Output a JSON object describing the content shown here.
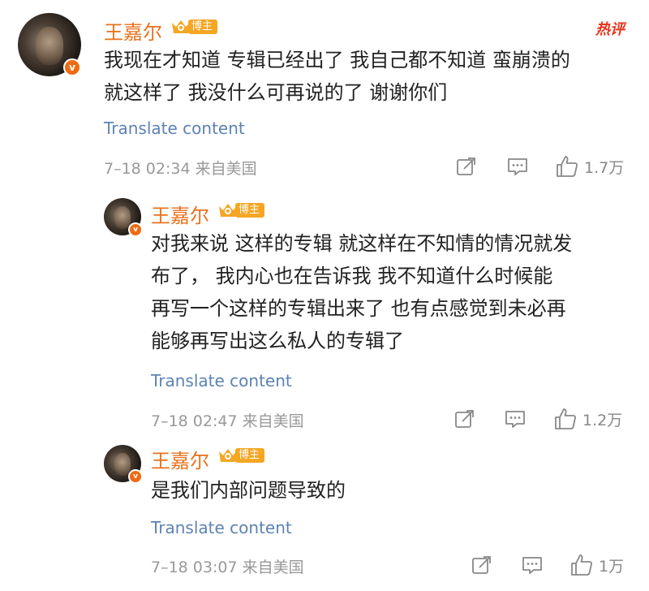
{
  "hot_label": "热评",
  "badge_label": "博主",
  "translate_label": "Translate content",
  "comments": [
    {
      "user": "王嘉尔",
      "lines": [
        "我现在才知道 专辑已经出了 我自己都不知道 蛮崩溃的",
        "就这样了 我没什么可再说的了  谢谢你们"
      ],
      "time": "7–18 02:34",
      "source": "来自美国",
      "likes": "1.7万"
    },
    {
      "user": "王嘉尔",
      "lines": [
        "对我来说 这样的专辑 就这样在不知情的情况就发",
        "布了，  我内心也在告诉我 我不知道什么时候能",
        "再写一个这样的专辑出来了 也有点感觉到未必再",
        "能够再写出这么私人的专辑了"
      ],
      "time": "7–18 02:47",
      "source": "来自美国",
      "likes": "1.2万"
    },
    {
      "user": "王嘉尔",
      "lines": [
        "是我们内部问题导致的"
      ],
      "time": "7–18 03:07",
      "source": "来自美国",
      "likes": "1万"
    }
  ],
  "colors": {
    "username": "#e8711c",
    "translate": "#5d82b3",
    "meta": "#999999",
    "hot": "#e8341c",
    "badge": "#f5a623"
  },
  "icons": [
    "verified-badge-icon",
    "crown-icon",
    "share-icon",
    "comment-icon",
    "like-icon"
  ]
}
